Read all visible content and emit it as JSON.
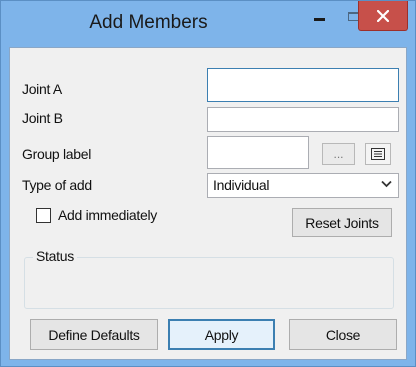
{
  "window": {
    "title": "Add Members",
    "minimize_icon": "minimize-icon",
    "maximize_icon": "maximize-icon",
    "close_icon": "close-icon",
    "close_color": "#c7504a",
    "frame_color": "#7eb4ea"
  },
  "form": {
    "joint_a": {
      "label": "Joint A",
      "value": ""
    },
    "joint_b": {
      "label": "Joint B",
      "value": ""
    },
    "group_label": {
      "label": "Group label",
      "value": "",
      "browse_label": "...",
      "list_icon": "list-icon"
    },
    "type_of_add": {
      "label": "Type of add",
      "selected": "Individual",
      "dropdown_icon": "chevron-down-icon"
    },
    "add_immediately": {
      "label": "Add immediately",
      "checked": false
    },
    "reset_joints_label": "Reset Joints",
    "status": {
      "legend": "Status",
      "text": ""
    }
  },
  "buttons": {
    "define_defaults": "Define Defaults",
    "apply": "Apply",
    "close": "Close"
  }
}
